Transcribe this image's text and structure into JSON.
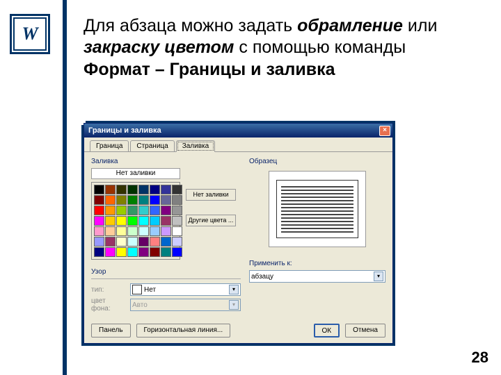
{
  "logo": "W",
  "heading": {
    "t1": "Для абзаца можно задать ",
    "t2": "обрамление",
    "t3": " или ",
    "t4": "закраску цветом",
    "t5": " с помощью команды ",
    "t6": "Формат – Границы и заливка"
  },
  "page_number": "28",
  "dialog": {
    "title": "Границы и заливка",
    "tabs": [
      "Граница",
      "Страница",
      "Заливка"
    ],
    "active_tab": 2,
    "fill_label": "Заливка",
    "no_fill": "Нет заливки",
    "no_fill_side": "Нет заливки",
    "more_colors": "Другие цвета ...",
    "pattern_label": "Узор",
    "type_label": "тип:",
    "type_value": "Нет",
    "bgcolor_label": "цвет фона:",
    "bgcolor_value": "Авто",
    "sample_label": "Образец",
    "apply_label": "Применить к:",
    "apply_value": "абзацу",
    "buttons": {
      "panel": "Панель",
      "hline": "Горизонтальная линия...",
      "ok": "ОК",
      "cancel": "Отмена"
    },
    "palette": [
      "#000000",
      "#993300",
      "#333300",
      "#003300",
      "#003366",
      "#000080",
      "#333399",
      "#333333",
      "#800000",
      "#ff6600",
      "#808000",
      "#008000",
      "#008080",
      "#0000ff",
      "#666699",
      "#808080",
      "#ff0000",
      "#ff9900",
      "#99cc00",
      "#339966",
      "#33cccc",
      "#3366ff",
      "#800080",
      "#969696",
      "#ff00ff",
      "#ffcc00",
      "#ffff00",
      "#00ff00",
      "#00ffff",
      "#00ccff",
      "#993366",
      "#c0c0c0",
      "#ff99cc",
      "#ffcc99",
      "#ffff99",
      "#ccffcc",
      "#ccffff",
      "#99ccff",
      "#cc99ff",
      "#ffffff",
      "#9999ff",
      "#993366",
      "#ffffcc",
      "#ccffff",
      "#660066",
      "#ff8080",
      "#0066cc",
      "#ccccff",
      "#000080",
      "#ff00ff",
      "#ffff00",
      "#00ffff",
      "#800080",
      "#800000",
      "#008080",
      "#0000ff"
    ]
  }
}
